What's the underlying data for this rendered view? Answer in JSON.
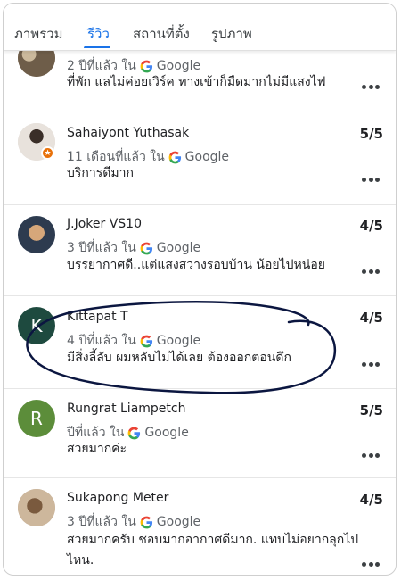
{
  "tabs": [
    {
      "label": "ภาพรวม",
      "active": false
    },
    {
      "label": "รีวิว",
      "active": true
    },
    {
      "label": "สถานที่ตั้ง",
      "active": false
    },
    {
      "label": "รูปภาพ",
      "active": false
    }
  ],
  "source_name": "Google",
  "reviews": [
    {
      "name": "",
      "time": "2 ปีที่แล้ว ใน",
      "text": "ที่พัก แลไม่ค่อยเวิร์ค ทางเข้าก็มืดมากไม่มีแสงไฟ",
      "rating": ""
    },
    {
      "name": "Sahaiyont Yuthasak",
      "time": "11 เดือนที่แล้ว ใน",
      "text": "บริการดีมาก",
      "rating": "5/5",
      "local_guide": true
    },
    {
      "name": "J.Joker VS10",
      "time": "3 ปีที่แล้ว ใน",
      "text": "บรรยากาศดี..แต่แสงสว่างรอบบ้าน น้อยไปหน่อย",
      "rating": "4/5"
    },
    {
      "name": "Kittapat T",
      "time": "4 ปีที่แล้ว ใน",
      "text": "มีสิ่งลี้ลับ ผมหลับไม่ได้เลย ต้องออกตอนดึก",
      "rating": "4/5",
      "avatar_letter": "K",
      "avatar_color": "#1e4a3f"
    },
    {
      "name": "Rungrat Liampetch",
      "time": "ปีที่แล้ว ใน",
      "text": "สวยมากค่ะ",
      "rating": "5/5",
      "avatar_letter": "R",
      "avatar_color": "#5c8d3a"
    },
    {
      "name": "Sukapong Meter",
      "time": "3 ปีที่แล้ว ใน",
      "text": "สวยมากครับ ชอบมากอากาศดีมาก. แทบไม่อยากลุกไปไหน.",
      "rating": "4/5"
    }
  ],
  "colors": {
    "accent": "#1a73e8",
    "annotation": "#0b1640"
  }
}
